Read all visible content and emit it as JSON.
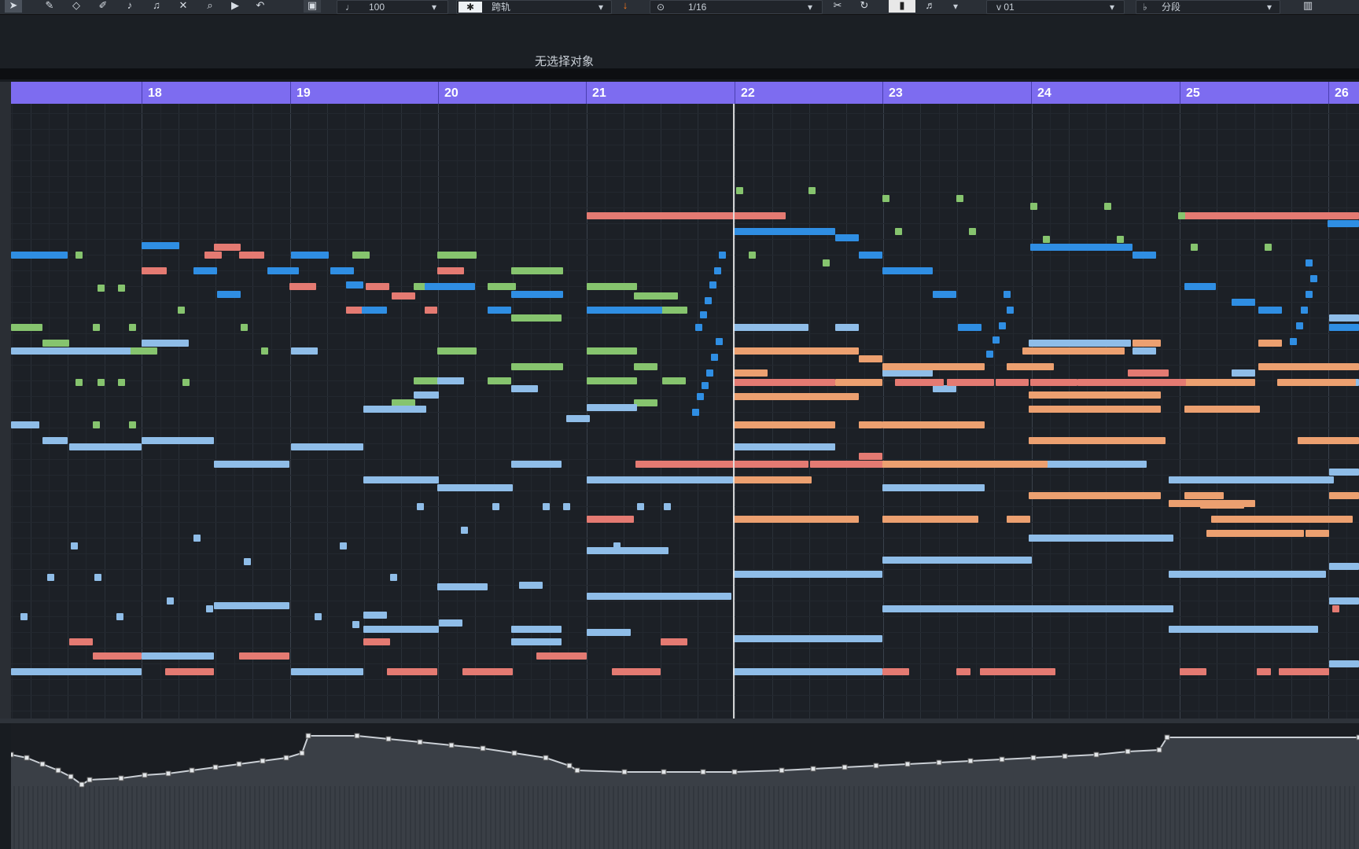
{
  "toolbar": {
    "tempo_value": "100",
    "mode_value": "跨轨",
    "quantize_value": "1/16",
    "velocity_value": "v 01",
    "segment_value": "分段"
  },
  "info_bar": {
    "status_text": "无选择对象"
  },
  "ruler": {
    "bars": [
      "18",
      "19",
      "20",
      "21",
      "22",
      "23",
      "24",
      "25",
      "26"
    ]
  },
  "colors": {
    "ruler": "#7d6cf0",
    "note_dark_blue": "#2f8ee3",
    "note_light_blue": "#8fbde8",
    "note_green": "#86c46e",
    "note_red": "#e47a72",
    "note_orange": "#eca070"
  },
  "icons": [
    "arrow-tool-icon",
    "pencil-icon",
    "eraser-icon",
    "brush-icon",
    "split-icon",
    "glue-icon",
    "mute-icon",
    "zoom-icon",
    "play-icon",
    "undo-icon",
    "snap-icon",
    "quantize-icon",
    "loop-icon"
  ]
}
